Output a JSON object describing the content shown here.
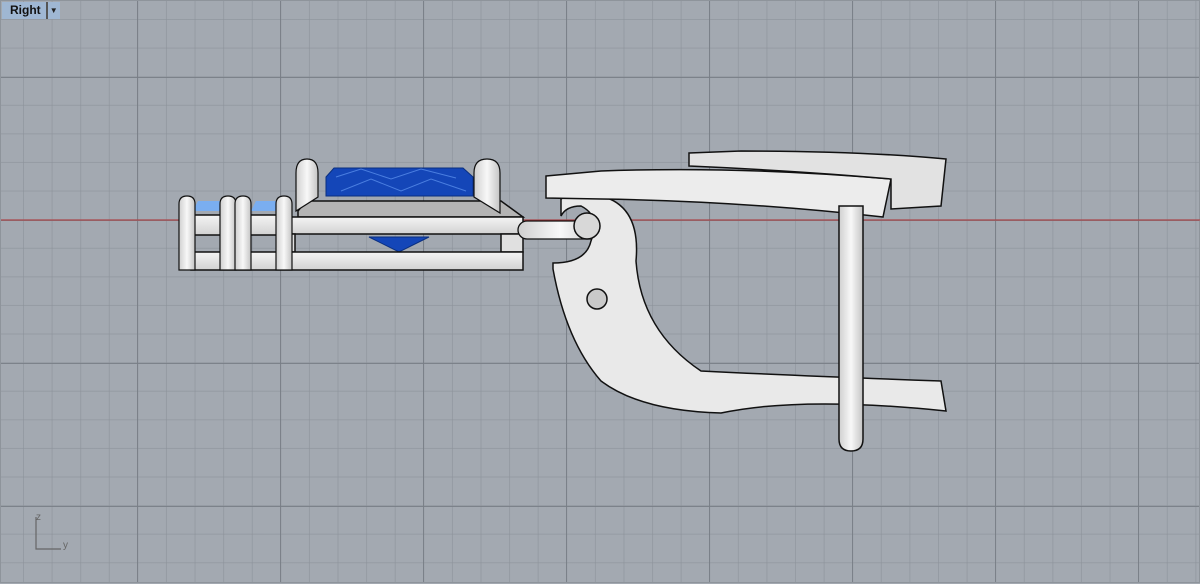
{
  "viewport": {
    "name": "Right",
    "dropdown_icon": "triangle-down-icon"
  },
  "axis_widget": {
    "vertical": "z",
    "horizontal": "y"
  },
  "colors": {
    "grid_bg": "#a3a9b1",
    "world_axis": "#b5373a",
    "gem": "#1446b8",
    "small_gem": "#7aaef0",
    "metal": "#e6e6e6"
  }
}
